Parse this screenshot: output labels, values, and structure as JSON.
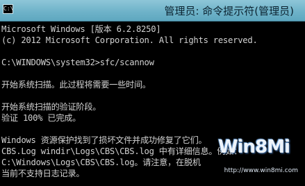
{
  "window": {
    "title": "管理员: 命令提示符(管理员)",
    "icon": "cmd-icon"
  },
  "console": {
    "lines": [
      "Microsoft Windows [版本 6.2.8250]",
      "(c) 2012 Microsoft Corporation. All rights reserved.",
      "C:\\WINDOWS\\system32>sfc/scannow",
      "开始系统扫描。此过程将需要一些时间。",
      "开始系统扫描的验证阶段。",
      "验证 100% 已完成。",
      "Windows 资源保护找到了损坏文件并成功修复了它们。",
      "CBS.Log windir\\Logs\\CBS\\CBS.log 中有详细信息。例如：",
      "C:\\Windows\\Logs\\CBS\\CBS.log。请注意，在脱机",
      "当前不支持日志记录。"
    ]
  },
  "watermark": {
    "logo": "Win8Mi",
    "url": "http://www.win8mi.com"
  }
}
